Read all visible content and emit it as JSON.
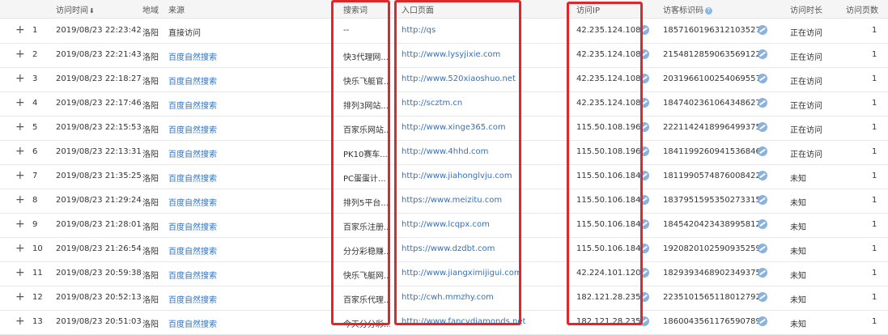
{
  "header": {
    "time": "访问时间",
    "sort_icon": "⬇",
    "region": "地域",
    "source": "来源",
    "keyword": "搜索词",
    "entry": "入口页面",
    "ip": "访问IP",
    "visitor": "访客标识码",
    "help_icon": "?",
    "duration": "访问时长",
    "pages": "访问页数"
  },
  "rows": [
    {
      "idx": "1",
      "time": "2019/08/23 22:23:42",
      "region": "洛阳",
      "source": "直接访问",
      "source_link": false,
      "keyword": "--",
      "entry": "http://qs",
      "ip": "42.235.124.108",
      "visitor": "1857160196312103527",
      "duration": "正在访问",
      "pages": "1"
    },
    {
      "idx": "2",
      "time": "2019/08/23 22:21:43",
      "region": "洛阳",
      "source": "百度自然搜索",
      "source_link": true,
      "keyword": "快3代理网...",
      "entry": "http://www.lysyjixie.com",
      "ip": "42.235.124.108",
      "visitor": "2154812859063569122",
      "duration": "正在访问",
      "pages": "1"
    },
    {
      "idx": "3",
      "time": "2019/08/23 22:18:27",
      "region": "洛阳",
      "source": "百度自然搜索",
      "source_link": true,
      "keyword": "快乐飞艇官...",
      "entry": "http://www.520xiaoshuo.net",
      "ip": "42.235.124.108",
      "visitor": "2031966100254069557",
      "duration": "正在访问",
      "pages": "1"
    },
    {
      "idx": "4",
      "time": "2019/08/23 22:17:46",
      "region": "洛阳",
      "source": "百度自然搜索",
      "source_link": true,
      "keyword": "排列3网站...",
      "entry": "http://scztm.cn",
      "ip": "42.235.124.108",
      "visitor": "1847402361064348627",
      "duration": "正在访问",
      "pages": "1"
    },
    {
      "idx": "5",
      "time": "2019/08/23 22:15:53",
      "region": "洛阳",
      "source": "百度自然搜索",
      "source_link": true,
      "keyword": "百家乐网站...",
      "entry": "http://www.xinge365.com",
      "ip": "115.50.108.196",
      "visitor": "2221142418996499375",
      "duration": "正在访问",
      "pages": "1"
    },
    {
      "idx": "6",
      "time": "2019/08/23 22:13:31",
      "region": "洛阳",
      "source": "百度自然搜索",
      "source_link": true,
      "keyword": "PK10赛车...",
      "entry": "http://www.4hhd.com",
      "ip": "115.50.108.196",
      "visitor": "1841199260941536846",
      "duration": "正在访问",
      "pages": "1"
    },
    {
      "idx": "7",
      "time": "2019/08/23 21:35:25",
      "region": "洛阳",
      "source": "百度自然搜索",
      "source_link": true,
      "keyword": "PC蛋蛋计...",
      "entry": "http://www.jiahonglvju.com",
      "ip": "115.50.106.184",
      "visitor": "1811990574876008422",
      "duration": "未知",
      "pages": "1"
    },
    {
      "idx": "8",
      "time": "2019/08/23 21:29:24",
      "region": "洛阳",
      "source": "百度自然搜索",
      "source_link": true,
      "keyword": "排列5平台...",
      "entry": "https://www.meizitu.com",
      "ip": "115.50.106.184",
      "visitor": "1837951595350273315",
      "duration": "未知",
      "pages": "1"
    },
    {
      "idx": "9",
      "time": "2019/08/23 21:28:01",
      "region": "洛阳",
      "source": "百度自然搜索",
      "source_link": true,
      "keyword": "百家乐注册...",
      "entry": "http://www.lcqpx.com",
      "ip": "115.50.106.184",
      "visitor": "1845420423438995812",
      "duration": "未知",
      "pages": "1"
    },
    {
      "idx": "10",
      "time": "2019/08/23 21:26:54",
      "region": "洛阳",
      "source": "百度自然搜索",
      "source_link": true,
      "keyword": "分分彩稳赚...",
      "entry": "https://www.dzdbt.com",
      "ip": "115.50.106.184",
      "visitor": "1920820102590935259",
      "duration": "未知",
      "pages": "1"
    },
    {
      "idx": "11",
      "time": "2019/08/23 20:59:38",
      "region": "洛阳",
      "source": "百度自然搜索",
      "source_link": true,
      "keyword": "快乐飞艇网...",
      "entry": "http://www.jiangximijigui.com",
      "ip": "42.224.101.120",
      "visitor": "1829393468902349375",
      "duration": "未知",
      "pages": "1"
    },
    {
      "idx": "12",
      "time": "2019/08/23 20:52:13",
      "region": "洛阳",
      "source": "百度自然搜索",
      "source_link": true,
      "keyword": "百家乐代理...",
      "entry": "http://cwh.mmzhy.com",
      "ip": "182.121.28.235",
      "visitor": "2235101565118012792",
      "duration": "未知",
      "pages": "1"
    },
    {
      "idx": "13",
      "time": "2019/08/23 20:51:03",
      "region": "洛阳",
      "source": "百度自然搜索",
      "source_link": true,
      "keyword": "今天分分彩...",
      "entry": "http://www.fancydiamonds.net",
      "ip": "182.121.28.235",
      "visitor": "1860043561176590789",
      "duration": "未知",
      "pages": "1"
    }
  ],
  "colors": {
    "link": "#2f72c4",
    "highlight_box": "#e0262a"
  }
}
